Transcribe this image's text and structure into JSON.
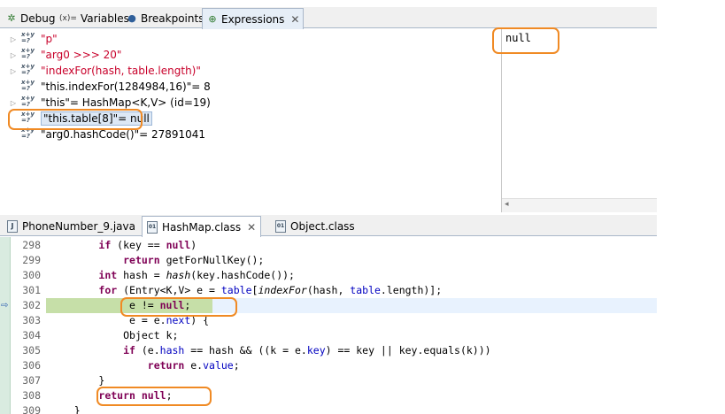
{
  "top_tabs": [
    {
      "label": "Debug",
      "icon": "debug-icon",
      "glyph": "✲"
    },
    {
      "label": "Variables",
      "icon": "variables-icon",
      "glyph": "(x)="
    },
    {
      "label": "Breakpoints",
      "icon": "breakpoints-icon",
      "glyph": "●"
    },
    {
      "label": "Expressions",
      "icon": "expressions-icon",
      "glyph": "⊕",
      "active": true,
      "close": "✕"
    }
  ],
  "expressions": [
    {
      "text": "\"p\"",
      "error": true,
      "expandable": true
    },
    {
      "text": "\"arg0 >>> 20\"",
      "error": true,
      "expandable": true
    },
    {
      "text": "\"indexFor(hash, table.length)\"",
      "error": true,
      "expandable": true
    },
    {
      "text": "\"this.indexFor(1284984,16)\"= 8",
      "error": false,
      "expandable": false
    },
    {
      "text": "\"this\"= HashMap<K,V>  (id=19)",
      "error": false,
      "expandable": true
    },
    {
      "text": "\"this.table[8]\"= null",
      "error": false,
      "expandable": false,
      "selected": true
    },
    {
      "text": "\"arg0.hashCode()\"= 27891041",
      "error": false,
      "expandable": false
    }
  ],
  "expression_icon_text": "x+y\n=?",
  "detail_value": "null",
  "detail_scroll_arrow": "◂",
  "editor_tabs": [
    {
      "label": "PhoneNumber_9.java",
      "icon": "java-file-icon",
      "glyph": "J"
    },
    {
      "label": "HashMap.class",
      "icon": "class-file-icon",
      "glyph": "01",
      "active": true,
      "close": "✕"
    },
    {
      "label": "Object.class",
      "icon": "class-file-icon",
      "glyph": "01"
    }
  ],
  "code_lines": [
    {
      "num": "298",
      "tokens": [
        {
          "t": "        "
        },
        {
          "t": "if",
          "c": "kw"
        },
        {
          "t": " (key == "
        },
        {
          "t": "null",
          "c": "kw"
        },
        {
          "t": ")"
        }
      ]
    },
    {
      "num": "299",
      "tokens": [
        {
          "t": "            "
        },
        {
          "t": "return",
          "c": "kw"
        },
        {
          "t": " getForNullKey();"
        }
      ]
    },
    {
      "num": "300",
      "tokens": [
        {
          "t": "        "
        },
        {
          "t": "int",
          "c": "kw"
        },
        {
          "t": " hash = "
        },
        {
          "t": "hash",
          "c": "it"
        },
        {
          "t": "(key.hashCode());"
        }
      ]
    },
    {
      "num": "301",
      "tokens": [
        {
          "t": "        "
        },
        {
          "t": "for",
          "c": "kw"
        },
        {
          "t": " (Entry<K,V> e = "
        },
        {
          "t": "table",
          "c": "fld"
        },
        {
          "t": "["
        },
        {
          "t": "indexFor",
          "c": "it"
        },
        {
          "t": "(hash, "
        },
        {
          "t": "table",
          "c": "fld"
        },
        {
          "t": ".length)];"
        }
      ]
    },
    {
      "num": "302",
      "tokens": [
        {
          "t": "             e != "
        },
        {
          "t": "null",
          "c": "kw"
        },
        {
          "t": ";"
        }
      ]
    },
    {
      "num": "303",
      "tokens": [
        {
          "t": "             e = e."
        },
        {
          "t": "next",
          "c": "fld"
        },
        {
          "t": ") {"
        }
      ]
    },
    {
      "num": "304",
      "tokens": [
        {
          "t": "            Object k;"
        }
      ]
    },
    {
      "num": "305",
      "tokens": [
        {
          "t": "            "
        },
        {
          "t": "if",
          "c": "kw"
        },
        {
          "t": " (e."
        },
        {
          "t": "hash",
          "c": "fld"
        },
        {
          "t": " == hash && ((k = e."
        },
        {
          "t": "key",
          "c": "fld"
        },
        {
          "t": ") == key || key.equals(k)))"
        }
      ]
    },
    {
      "num": "306",
      "tokens": [
        {
          "t": "                "
        },
        {
          "t": "return",
          "c": "kw"
        },
        {
          "t": " e."
        },
        {
          "t": "value",
          "c": "fld"
        },
        {
          "t": ";"
        }
      ]
    },
    {
      "num": "307",
      "tokens": [
        {
          "t": "        }"
        }
      ]
    },
    {
      "num": "308",
      "tokens": [
        {
          "t": "        "
        },
        {
          "t": "return",
          "c": "kw"
        },
        {
          "t": " "
        },
        {
          "t": "null",
          "c": "kw"
        },
        {
          "t": ";"
        }
      ]
    },
    {
      "num": "309",
      "tokens": [
        {
          "t": "    }"
        }
      ]
    }
  ],
  "current_line": "302",
  "instruction_pointer_glyph": "⇨",
  "colors": {
    "highlight_outline": "#f08a24",
    "current_line": "#e8f2fe",
    "keyword": "#7f0055",
    "field": "#0000c0",
    "error_text": "#c8002a"
  }
}
